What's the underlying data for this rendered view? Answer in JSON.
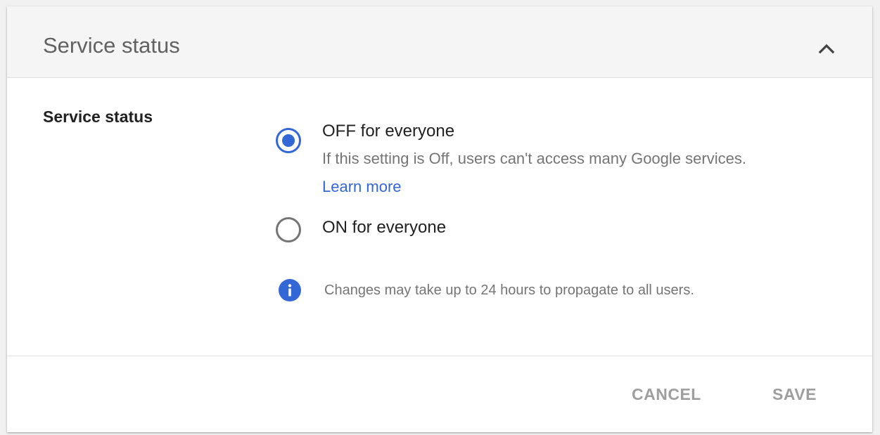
{
  "header": {
    "title": "Service status",
    "collapse_icon": "chevron-up-icon"
  },
  "setting": {
    "label": "Service status",
    "selected": "off",
    "options": [
      {
        "id": "off",
        "label": "OFF for everyone",
        "description": "If this setting is Off, users can't access many Google services.",
        "link_text": "Learn more",
        "checked": true
      },
      {
        "id": "on",
        "label": "ON for everyone",
        "checked": false
      }
    ],
    "info": {
      "icon": "info-icon",
      "text": "Changes may take up to 24 hours to propagate to all users."
    }
  },
  "footer": {
    "cancel_label": "CANCEL",
    "save_label": "SAVE"
  },
  "colors": {
    "accent": "#3367d6",
    "text_primary": "#212121",
    "text_secondary": "#757575",
    "button_disabled": "#9e9e9e",
    "header_bg": "#f5f5f5"
  }
}
